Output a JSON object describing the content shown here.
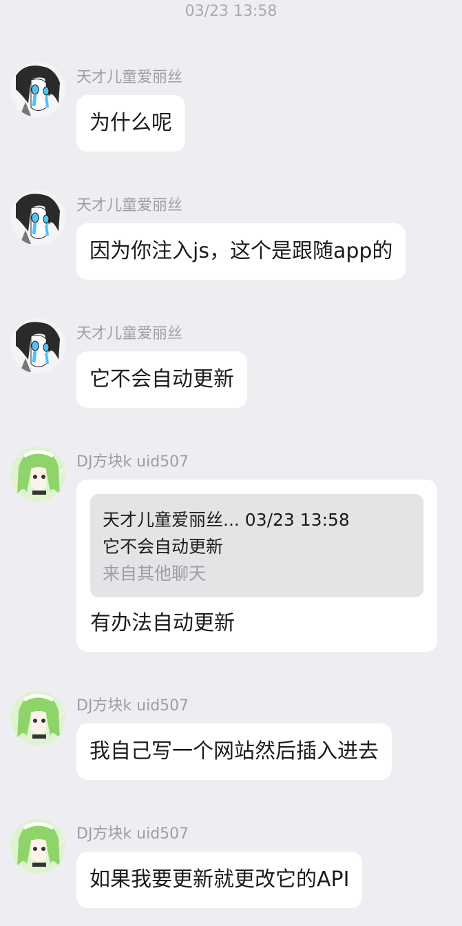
{
  "chat": {
    "timestamp": "03/23 13:58",
    "messages": [
      {
        "sender": "天才儿童爱丽丝",
        "avatar_icon": "anime-girl-black-hair-avatar",
        "text": "为什么呢"
      },
      {
        "sender": "天才儿童爱丽丝",
        "avatar_icon": "anime-girl-black-hair-avatar",
        "text": "因为你注入js，这个是跟随app的"
      },
      {
        "sender": "天才儿童爱丽丝",
        "avatar_icon": "anime-girl-black-hair-avatar",
        "text": "它不会自动更新"
      },
      {
        "sender": "DJ方块k uid507",
        "avatar_icon": "green-hair-maid-avatar",
        "quote": {
          "header": "天才儿童爱丽丝... 03/23 13:58",
          "text": "它不会自动更新",
          "origin": "来自其他聊天"
        },
        "text": "有办法自动更新"
      },
      {
        "sender": "DJ方块k uid507",
        "avatar_icon": "green-hair-maid-avatar",
        "text": "我自己写一个网站然后插入进去"
      },
      {
        "sender": "DJ方块k uid507",
        "avatar_icon": "green-hair-maid-avatar",
        "text": "如果我要更新就更改它的API"
      }
    ]
  },
  "colors": {
    "background": "#ededf2",
    "bubble": "#ffffff",
    "quote_box": "#e4e4e6",
    "muted_text": "#9d9da4",
    "avatar_accent_blue": "#4fc3f7",
    "avatar_accent_green": "#8fd46a"
  }
}
